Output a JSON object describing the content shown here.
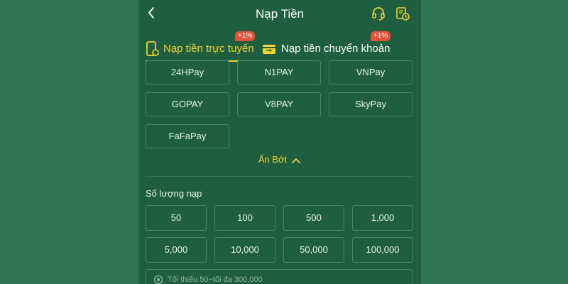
{
  "header": {
    "title": "Nạp Tiền",
    "back_icon": "chevron-left-icon",
    "support_icon": "headset-icon",
    "history_icon": "history-icon"
  },
  "tabs": [
    {
      "label": "Nạp tiền trực tuyến",
      "badge": "+1%",
      "icon": "phone-icon",
      "active": true
    },
    {
      "label": "Nạp tiền chuyển khoản",
      "badge": "+1%",
      "icon": "card-icon",
      "active": false
    }
  ],
  "methods": [
    "24HPay",
    "N1PAY",
    "VNPay",
    "GOPAY",
    "V8PAY",
    "SkyPay",
    "FaFaPay"
  ],
  "collapse_label": "Ẩn Bớt",
  "amount": {
    "label": "Số lượng nạp",
    "options": [
      "50",
      "100",
      "500",
      "1,000",
      "5,000",
      "10,000",
      "50,000",
      "100,000"
    ],
    "input_placeholder": "Tối thiểu 50~tối đa 300,000"
  },
  "colors": {
    "page_bg": "#2f7651",
    "panel_bg": "#1f5f3f",
    "accent_yellow": "#f1d239",
    "badge_red": "#e0533c",
    "border": "#3f8a62"
  }
}
